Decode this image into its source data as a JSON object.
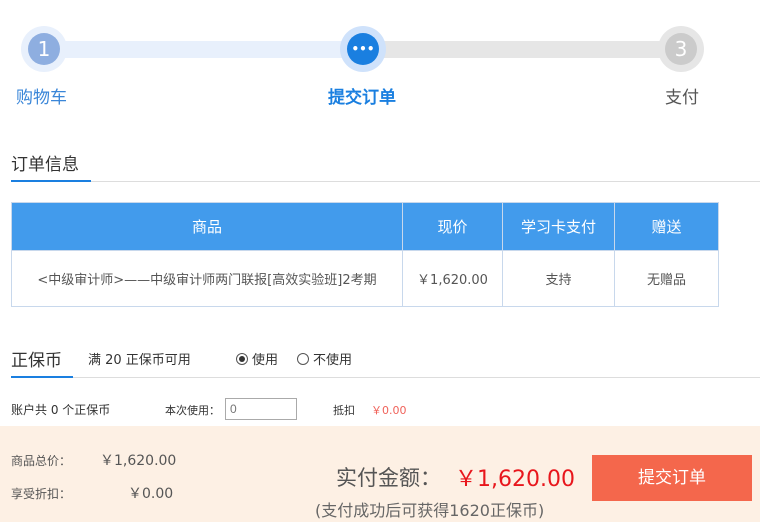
{
  "steps": [
    {
      "num": "1",
      "label": "购物车"
    },
    {
      "num": "•••",
      "label": "提交订单"
    },
    {
      "num": "3",
      "label": "支付"
    }
  ],
  "order_section": {
    "title": "订单信息"
  },
  "table": {
    "headers": [
      "商品",
      "现价",
      "学习卡支付",
      "赠送"
    ],
    "rows": [
      [
        "<中级审计师>——中级审计师两门联报[高效实验班]2考期",
        "￥1,620.00",
        "支持",
        "无赠品"
      ]
    ]
  },
  "coin": {
    "title": "正保币",
    "available": "满 20 正保币可用",
    "use_label": "使用",
    "nouse_label": "不使用",
    "account": "账户共 0 个正保币",
    "use_now_label": "本次使用：",
    "input_placeholder": "0",
    "deduct_label": "抵扣",
    "deduct_value": "￥0.00"
  },
  "summary": {
    "total_label": "商品总价：",
    "total_value": "￥1,620.00",
    "discount_label": "享受折扣：",
    "discount_value": "￥0.00",
    "pay_label": "实付金额：",
    "pay_value": "￥1,620.00",
    "note": "(支付成功后可获得1620正保币)",
    "submit": "提交订单"
  }
}
